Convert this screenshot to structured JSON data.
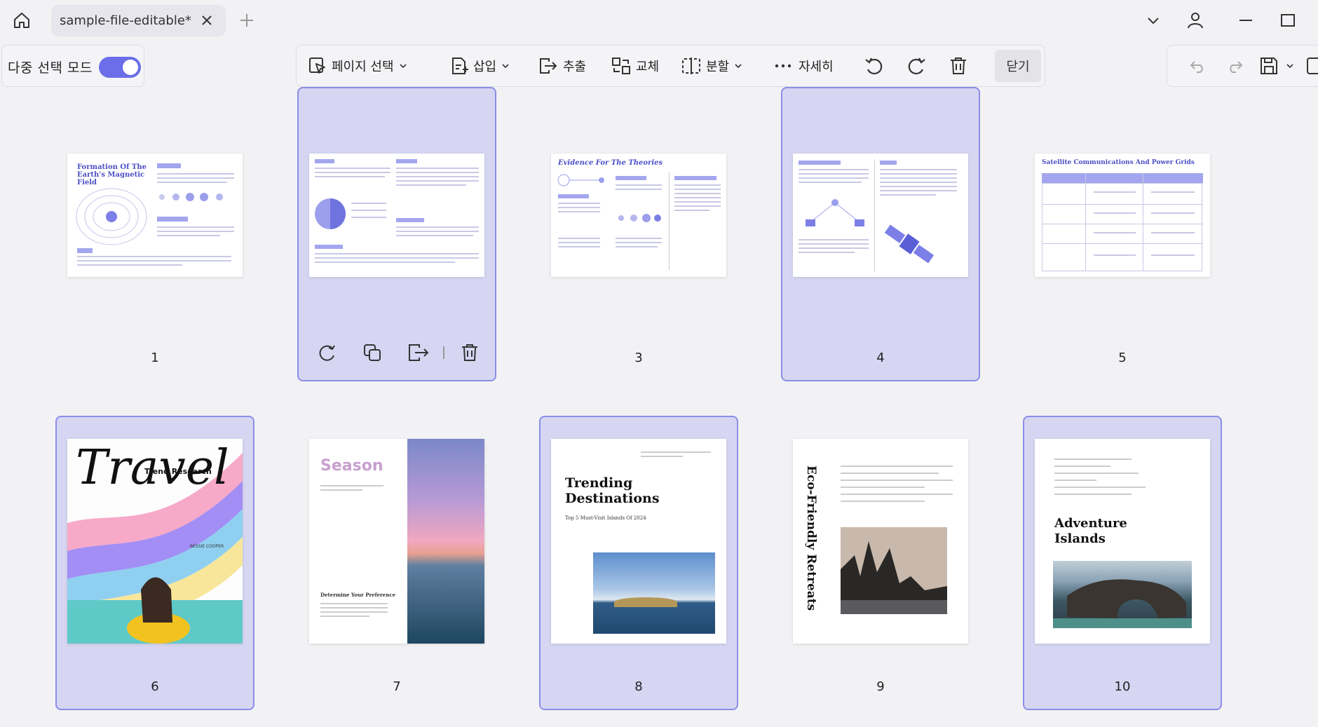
{
  "titlebar": {
    "tab_title": "sample-file-editable*",
    "icons": [
      "home-icon",
      "close-icon",
      "plus-icon",
      "chevron-down-icon",
      "user-icon",
      "minimize-icon",
      "maximize-icon"
    ]
  },
  "multiselect": {
    "label": "다중 선택 모드",
    "enabled": true
  },
  "toolbar": {
    "page_select": "페이지 선택",
    "insert": "삽입",
    "extract": "추출",
    "replace": "교체",
    "split": "분할",
    "more": "자세히",
    "close": "닫기"
  },
  "colors": {
    "accent": "#6b6ee8",
    "selected_bg": "#d6d6f3",
    "selected_border": "#8b8ee6",
    "thumb_accent": "#4b4fc7"
  },
  "pages": [
    {
      "number": "1",
      "selected": false,
      "title": "Formation Of The Earth's Magnetic Field"
    },
    {
      "number": "2",
      "selected": true
    },
    {
      "number": "3",
      "selected": false,
      "title": "Evidence For The Theories"
    },
    {
      "number": "4",
      "selected": true
    },
    {
      "number": "5",
      "selected": false,
      "title": "Satellite Communications And Power Grids"
    },
    {
      "number": "6",
      "selected": true,
      "title": "Travel",
      "subtitle": "Trend Research",
      "author": "BESSIE COOPER"
    },
    {
      "number": "7",
      "selected": false,
      "title": "Season",
      "heading": "Determine Your Preference"
    },
    {
      "number": "8",
      "selected": true,
      "title": "Trending Destinations",
      "subtitle": "Top 5 Must-Visit Islands Of 2024"
    },
    {
      "number": "9",
      "selected": false,
      "title": "Eco-Friendly Retreats"
    },
    {
      "number": "10",
      "selected": true,
      "title": "Adventure Islands"
    }
  ]
}
